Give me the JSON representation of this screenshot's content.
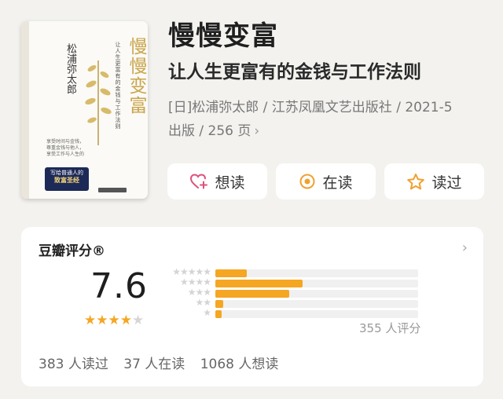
{
  "book": {
    "title": "慢慢变富",
    "subtitle": "让人生更富有的金钱与工作法则",
    "meta_line1": "[日]松浦弥太郎 / 江苏凤凰文艺出版社 / 2021-5",
    "meta_line2": "出版 / 256 页",
    "meta_chevron": "›"
  },
  "cover": {
    "title": "慢慢变富",
    "author": "松浦弥太郎",
    "sub": "让人生更富有的金钱与工作法则",
    "tag": "享受时间与金钱，尊重金钱与他人，享受工作与人生的",
    "band_line1": "写给普通人的",
    "band_line2": "致富圣经",
    "accent": "#c9a44b",
    "band_color": "#1d2a57"
  },
  "actions": [
    {
      "label": "想读",
      "icon": "heart-plus-icon"
    },
    {
      "label": "在读",
      "icon": "target-icon"
    },
    {
      "label": "读过",
      "icon": "star-outline-icon"
    }
  ],
  "rating": {
    "header": "豆瓣评分®",
    "chevron": "›",
    "score": "7.6",
    "stars": 4,
    "max_stars": 5,
    "distribution": [
      {
        "stars": 5,
        "percent": 15.5
      },
      {
        "stars": 4,
        "percent": 43.0
      },
      {
        "stars": 3,
        "percent": 36.5
      },
      {
        "stars": 2,
        "percent": 4.0
      },
      {
        "stars": 1,
        "percent": 1.0
      }
    ],
    "count_label": "355 人评分",
    "bar_color": "#f5a623"
  },
  "stats": {
    "read": "383 人读过",
    "reading": "37 人在读",
    "want": "1068 人想读"
  }
}
